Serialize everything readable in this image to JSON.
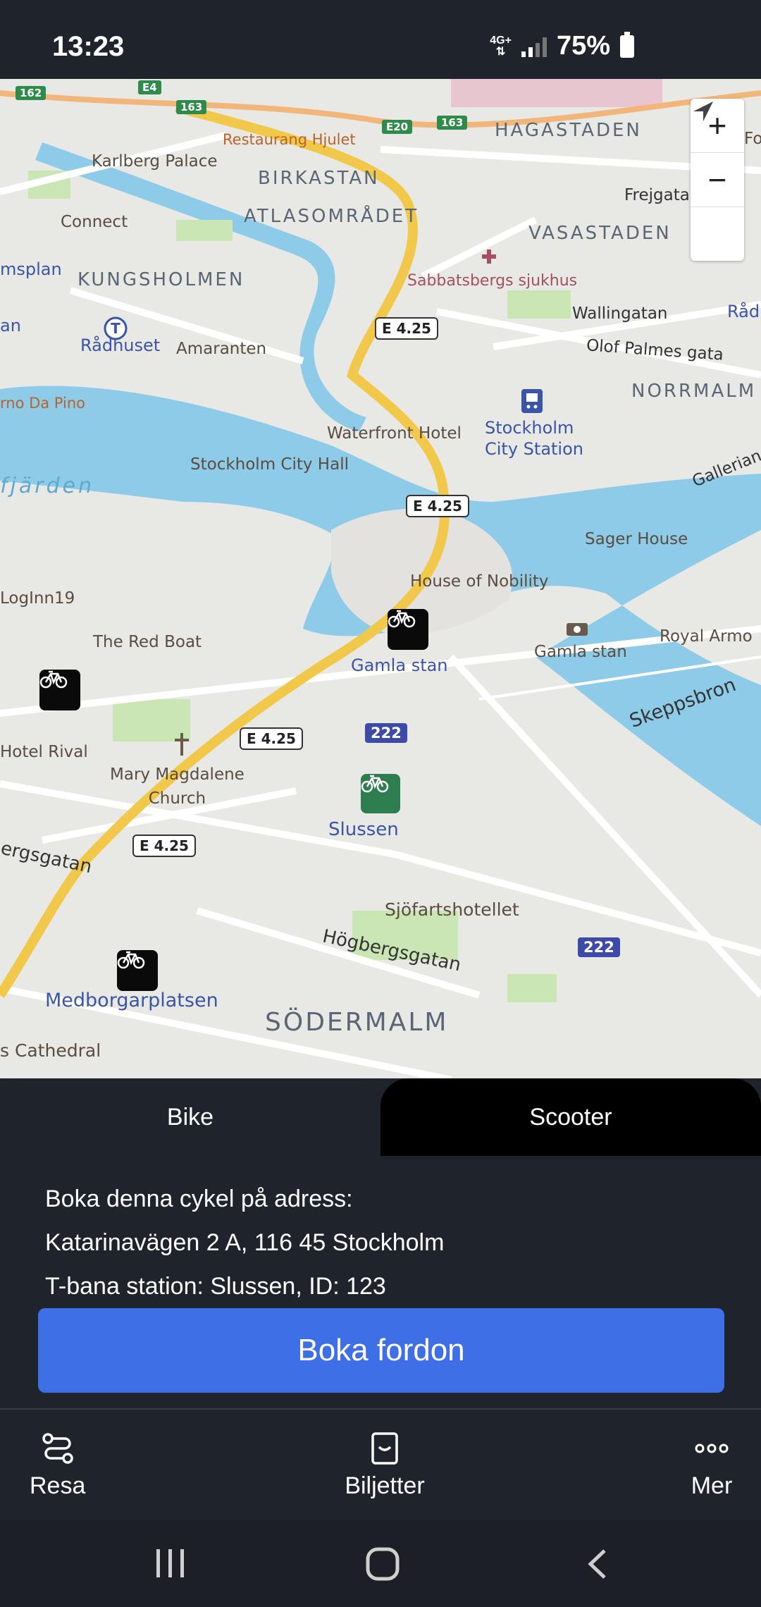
{
  "status_bar": {
    "time": "13:23",
    "network": "4G+",
    "battery": "75%"
  },
  "map": {
    "districts": [
      "BIRKASTAN",
      "ATLASOMRÅDET",
      "HAGASTADEN",
      "VASASTADEN",
      "KUNGSHOLMEN",
      "NORRMALM",
      "SÖDERMALM"
    ],
    "water_label": "fjärden",
    "places": {
      "karlberg": "Karlberg Palace",
      "restaurang": "Restaurang Hjulet",
      "connect": "Connect",
      "sabbatsbergs": "Sabbatsbergs sjukhus",
      "radhuset": "Rådhuset",
      "amaranten": "Amaranten",
      "pino": "rno Da Pino",
      "waterfront": "Waterfront Hotel",
      "city_station": "Stockholm\nCity Station",
      "city_hall": "Stockholm City Hall",
      "sager": "Sager House",
      "nobility": "House of Nobility",
      "loginn": "LogInn19",
      "red_boat": "The Red Boat",
      "gamla_stan_metro": "Gamla stan",
      "gamla_stan": "Gamla stan",
      "royal": "Royal Armo",
      "rival": "Hotel Rival",
      "mary": "Mary Magdalene\nChurch",
      "slussen": "Slussen",
      "sjofart": "Sjöfartshotellet",
      "medborgar": "Medborgarplatsen",
      "cathedral": "s Cathedral",
      "msplan": "msplan",
      "an": "an",
      "radm": "Rådm",
      "fo": "Fo"
    },
    "streets": {
      "frejgatan": "Frejgatan",
      "wallingatan": "Wallingatan",
      "olof": "Olof Palmes gata",
      "gallerian": "Gallerian",
      "skeppsbron": "Skeppsbron",
      "hogbergsgatan": "Högbergsgatan",
      "ergsgatan": "ergsgatan"
    },
    "shields": {
      "e425": "E 4.25",
      "r222": "222",
      "e20": "E20",
      "r162": "162",
      "r163": "163",
      "e4": "E4"
    },
    "controls": {
      "zoom_in": "+",
      "zoom_out": "−"
    }
  },
  "tabs": {
    "bike": "Bike",
    "scooter": "Scooter",
    "active": "Bike"
  },
  "booking": {
    "line1": "Boka denna cykel på adress:",
    "line2": "Katarinavägen 2 A, 116 45 Stockholm",
    "line3": "T-bana station: Slussen, ID: 123",
    "button": "Boka fordon"
  },
  "nav": {
    "resa": "Resa",
    "biljetter": "Biljetter",
    "mer": "Mer"
  },
  "icons": {
    "bike_marker": "bicycle-icon",
    "compass": "compass-icon"
  },
  "colors": {
    "accent": "#3f6fe6",
    "panel": "#1f232b",
    "water": "#8ecbe8",
    "selected_marker": "#2e7d4f"
  }
}
